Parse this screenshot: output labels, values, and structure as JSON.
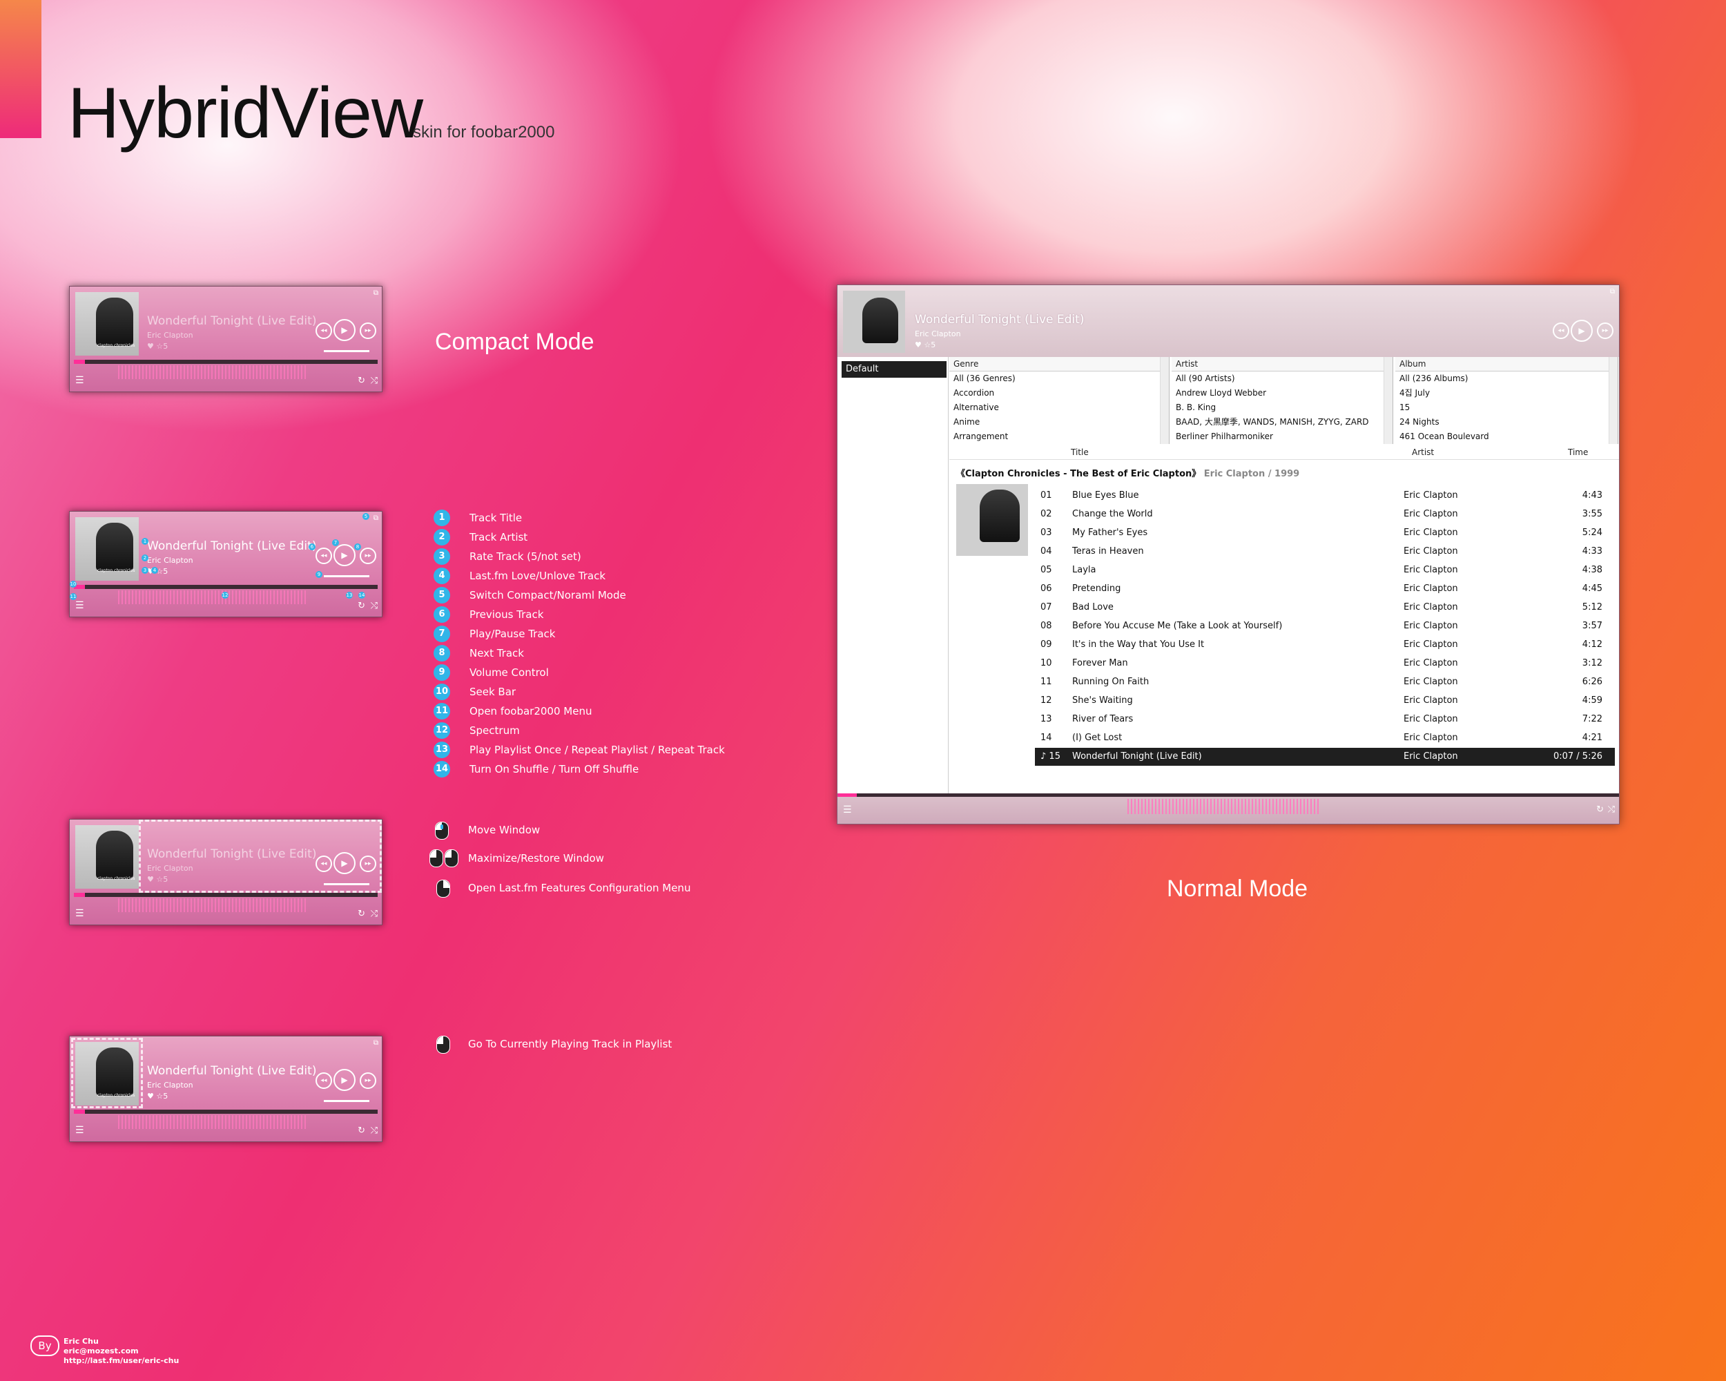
{
  "header": {
    "title": "HybridView",
    "subtitle": "skin for foobar2000"
  },
  "player": {
    "track_title": "Wonderful Tonight (Live Edit)",
    "track_artist": "Eric Clapton",
    "rating": "♥ ☆5",
    "album_art_label": "clapton chronicles",
    "prev_icon": "◂◂",
    "play_icon": "▶",
    "next_icon": "▸▸",
    "menu_icon": "☰",
    "repeat_icon": "↻",
    "shuffle_icon": "⤭",
    "mode_icon": "⧉"
  },
  "labels": {
    "compact_mode": "Compact Mode",
    "normal_mode": "Normal Mode"
  },
  "legend": [
    {
      "num": "1",
      "text": "Track Title"
    },
    {
      "num": "2",
      "text": "Track Artist"
    },
    {
      "num": "3",
      "text": "Rate Track (5/not set)"
    },
    {
      "num": "4",
      "text": "Last.fm Love/Unlove Track"
    },
    {
      "num": "5",
      "text": "Switch Compact/Noraml Mode"
    },
    {
      "num": "6",
      "text": "Previous Track"
    },
    {
      "num": "7",
      "text": "Play/Pause Track"
    },
    {
      "num": "8",
      "text": "Next Track"
    },
    {
      "num": "9",
      "text": "Volume Control"
    },
    {
      "num": "10",
      "text": "Seek Bar"
    },
    {
      "num": "11",
      "text": "Open foobar2000 Menu"
    },
    {
      "num": "12",
      "text": "Spectrum"
    },
    {
      "num": "13",
      "text": "Play Playlist Once / Repeat Playlist / Repeat Track"
    },
    {
      "num": "14",
      "text": "Turn On Shuffle / Turn Off Shuffle"
    }
  ],
  "mouse_actions": {
    "move": "Move Window",
    "maximize": "Maximize/Restore Window",
    "lastfm": "Open Last.fm Features Configuration Menu",
    "goto": "Go To Currently Playing Track in Playlist"
  },
  "normal_window": {
    "playlist_tab": "Default",
    "genre": {
      "header": "Genre",
      "items": [
        "All (36 Genres)",
        "Accordion",
        "Alternative",
        "Anime",
        "Arrangement"
      ]
    },
    "artist": {
      "header": "Artist",
      "items": [
        "All (90 Artists)",
        "Andrew Lloyd Webber",
        "B. B. King",
        "BAAD, 大黒摩季, WANDS, MANISH, ZYYG, ZARD",
        "Berliner Philharmoniker"
      ]
    },
    "album": {
      "header": "Album",
      "items": [
        "All (236 Albums)",
        "4집 July",
        "15",
        "24 Nights",
        "461 Ocean Boulevard"
      ]
    },
    "columns": {
      "title": "Title",
      "artist": "Artist",
      "time": "Time"
    },
    "group_title": "《Clapton Chronicles - The Best of Eric Clapton》",
    "group_sub": "Eric Clapton / 1999",
    "tracks": [
      {
        "no": "01",
        "title": "Blue Eyes Blue",
        "artist": "Eric Clapton",
        "time": "4:43"
      },
      {
        "no": "02",
        "title": "Change the World",
        "artist": "Eric Clapton",
        "time": "3:55"
      },
      {
        "no": "03",
        "title": "My Father's Eyes",
        "artist": "Eric Clapton",
        "time": "5:24"
      },
      {
        "no": "04",
        "title": "Teras in Heaven",
        "artist": "Eric Clapton",
        "time": "4:33"
      },
      {
        "no": "05",
        "title": "Layla",
        "artist": "Eric Clapton",
        "time": "4:38"
      },
      {
        "no": "06",
        "title": "Pretending",
        "artist": "Eric Clapton",
        "time": "4:45"
      },
      {
        "no": "07",
        "title": "Bad Love",
        "artist": "Eric Clapton",
        "time": "5:12"
      },
      {
        "no": "08",
        "title": "Before You Accuse Me (Take a Look at Yourself)",
        "artist": "Eric Clapton",
        "time": "3:57"
      },
      {
        "no": "09",
        "title": "It's in the Way that You Use It",
        "artist": "Eric Clapton",
        "time": "4:12"
      },
      {
        "no": "10",
        "title": "Forever Man",
        "artist": "Eric Clapton",
        "time": "3:12"
      },
      {
        "no": "11",
        "title": "Running On Faith",
        "artist": "Eric Clapton",
        "time": "6:26"
      },
      {
        "no": "12",
        "title": "She's Waiting",
        "artist": "Eric Clapton",
        "time": "4:59"
      },
      {
        "no": "13",
        "title": "River of Tears",
        "artist": "Eric Clapton",
        "time": "7:22"
      },
      {
        "no": "14",
        "title": "(I) Get Lost",
        "artist": "Eric Clapton",
        "time": "4:21"
      },
      {
        "no": "♪ 15",
        "title": "Wonderful Tonight (Live Edit)",
        "artist": "Eric Clapton",
        "time": "0:07 / 5:26",
        "playing": true
      }
    ]
  },
  "credits": {
    "by": "By",
    "name": "Eric Chu",
    "email": "eric@mozest.com",
    "url": "http://last.fm/user/eric-chu"
  },
  "colors": {
    "accent": "#31b5e8",
    "seek_fill": "#ff2f98",
    "playing_row": "#1f1f1f"
  }
}
